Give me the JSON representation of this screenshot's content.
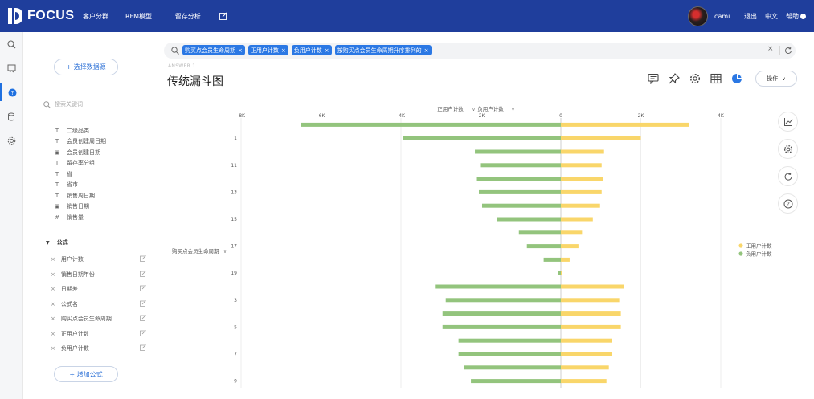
{
  "app": {
    "logo_text": "FOCUS",
    "nav": [
      "客户分群",
      "RFM模型...",
      "留存分析"
    ],
    "user_name": "cami...",
    "logout": "退出",
    "language": "中文",
    "help": "帮助"
  },
  "panel": {
    "select_datasource": "+ 选择数据源",
    "search_placeholder": "搜索关键词",
    "fields": [
      {
        "icon": "text-field-icon",
        "label": "二级品类"
      },
      {
        "icon": "text-field-icon",
        "label": "会员创建周日期"
      },
      {
        "icon": "date-field-icon",
        "label": "会员创建日期"
      },
      {
        "icon": "text-field-icon",
        "label": "留存率分组"
      },
      {
        "icon": "text-field-icon",
        "label": "省"
      },
      {
        "icon": "text-field-icon",
        "label": "省市"
      },
      {
        "icon": "text-field-icon",
        "label": "销售周日期"
      },
      {
        "icon": "date-field-icon",
        "label": "销售日期"
      },
      {
        "icon": "number-field-icon",
        "label": "销售量"
      }
    ],
    "formula_section": "公式",
    "formulas": [
      "用户计数",
      "销售日期年份",
      "日期差",
      "公式名",
      "购买点会员生命周期",
      "正用户计数",
      "负用户计数"
    ],
    "add_formula": "+ 增加公式"
  },
  "query": {
    "chips": [
      "购买点会员生命周期",
      "正用户计数",
      "负用户计数",
      "按购买点会员生命周期升序排列的"
    ],
    "clear": "×"
  },
  "answer": {
    "label": "ANSWER 1",
    "title": "传统漏斗图",
    "ops_button": "操作"
  },
  "colors": {
    "positive": "#f9d66a",
    "negative": "#93c47d",
    "brand": "#1f3e9c",
    "chip": "#2b78e4"
  },
  "chart_data": {
    "type": "bar",
    "orientation": "horizontal",
    "x_ticks": [
      "-8K",
      "-6K",
      "-4K",
      "-2K",
      "0",
      "2K",
      "4K"
    ],
    "xlim": [
      -8000,
      4000
    ],
    "y_axis_label": "购买点会员生命周期",
    "header_measures": [
      "正用户计数",
      "负用户计数"
    ],
    "y_tick_labels": {
      "1": "1",
      "3": "11",
      "5": "13",
      "7": "15",
      "9": "17",
      "11": "19",
      "13": "3",
      "15": "5",
      "17": "7",
      "19": "9"
    },
    "series": [
      {
        "name": "正用户计数",
        "color": "#f9d66a",
        "values": [
          3200,
          2000,
          1080,
          1020,
          1060,
          1020,
          980,
          800,
          530,
          440,
          220,
          40,
          1580,
          1460,
          1500,
          1500,
          1280,
          1280,
          1200,
          1140
        ]
      },
      {
        "name": "负用户计数",
        "color": "#93c47d",
        "values": [
          -6500,
          -3950,
          -2150,
          -2020,
          -2120,
          -2050,
          -1970,
          -1600,
          -1050,
          -850,
          -430,
          -80,
          -3150,
          -2880,
          -2960,
          -2960,
          -2560,
          -2560,
          -2420,
          -2250
        ]
      }
    ],
    "legend": [
      "正用户计数",
      "负用户计数"
    ],
    "legend_position": "right",
    "grid": true
  }
}
